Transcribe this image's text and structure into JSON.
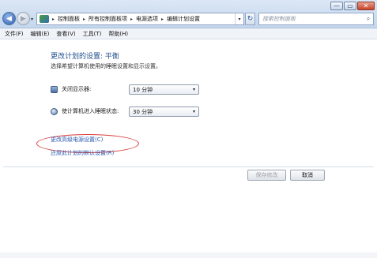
{
  "window": {
    "controls": {
      "minimize": "—",
      "maximize": "▭",
      "close": "✕"
    }
  },
  "nav": {
    "back_icon": "◀",
    "forward_icon": "▶",
    "history_dropdown": "▾"
  },
  "address_bar": {
    "breadcrumbs": [
      "控制面板",
      "所有控制面板项",
      "电源选项",
      "编辑计划设置"
    ],
    "separator": "▸",
    "dropdown": "▾"
  },
  "refresh_icon": "↻",
  "search": {
    "placeholder": "搜索控制面板",
    "icon": "⌕"
  },
  "menu": {
    "items": [
      "文件(F)",
      "编辑(E)",
      "查看(V)",
      "工具(T)",
      "帮助(H)"
    ]
  },
  "main": {
    "title": "更改计划的设置: 平衡",
    "subtitle": "选择希望计算机使用的睡眠设置和显示设置。",
    "settings": [
      {
        "label": "关闭显示器:",
        "value": "10 分钟",
        "icon": "monitor-icon"
      },
      {
        "label": "使计算机进入睡眠状态:",
        "value": "30 分钟",
        "icon": "sleep-icon"
      }
    ],
    "dropdown_arrow": "▾",
    "links": {
      "advanced": "更改高级电源设置(C)",
      "restore": "还原此计划的默认设置(R)"
    },
    "buttons": {
      "save": "保存修改",
      "cancel": "取消"
    }
  },
  "colors": {
    "title": "#1f4e8c",
    "link": "#2a5bb5",
    "annotation_ellipse": "#d83c3c"
  }
}
